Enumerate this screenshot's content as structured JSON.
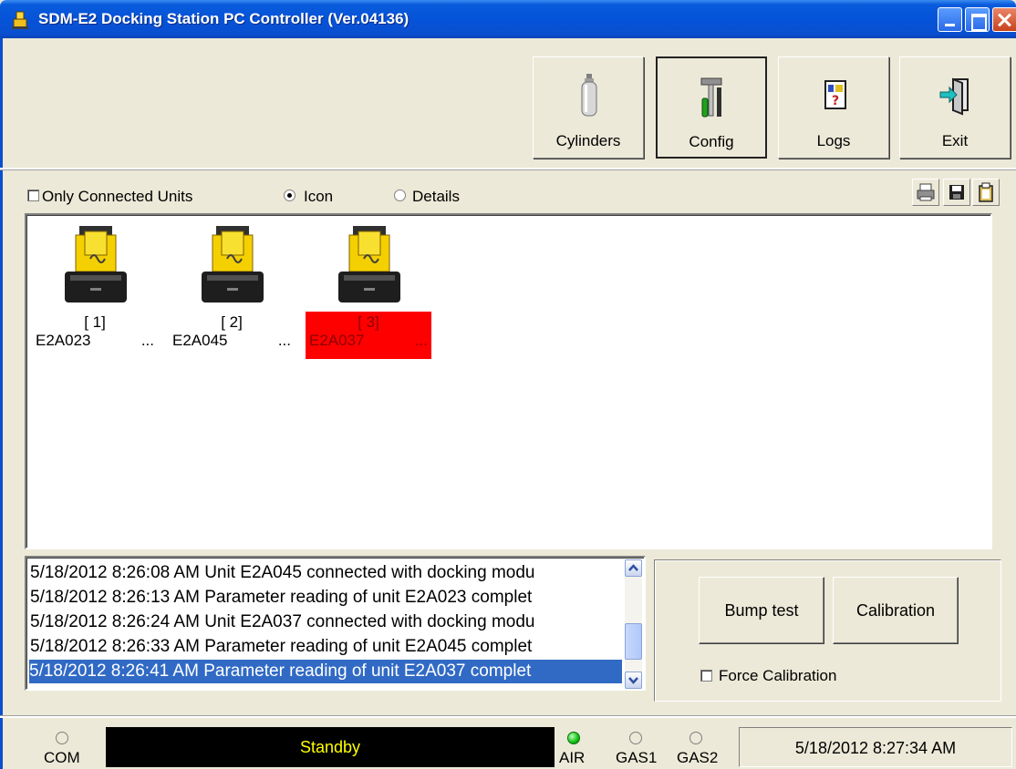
{
  "window": {
    "title": "SDM-E2 Docking Station PC Controller (Ver.04136)"
  },
  "toolbar": {
    "cylinders_label": "Cylinders",
    "config_label": "Config",
    "logs_label": "Logs",
    "exit_label": "Exit"
  },
  "filters": {
    "only_connected_label": "Only Connected Units",
    "only_connected_checked": false,
    "view_icon_label": "Icon",
    "view_details_label": "Details",
    "selected_view": "Icon"
  },
  "units": [
    {
      "num": "[ 1]",
      "name": "E2A023",
      "ellipsis": "...",
      "selected": false
    },
    {
      "num": "[ 2]",
      "name": "E2A045",
      "ellipsis": "...",
      "selected": false
    },
    {
      "num": "[ 3]",
      "name": "E2A037",
      "ellipsis": "...",
      "selected": true
    }
  ],
  "log": [
    "5/18/2012 8:26:08 AM Unit E2A045 connected with docking modu",
    "5/18/2012 8:26:13 AM Parameter reading of unit E2A023 complet",
    "5/18/2012 8:26:24 AM Unit E2A037 connected with docking modu",
    "5/18/2012 8:26:33 AM Parameter reading of unit E2A045 complet",
    "5/18/2012 8:26:41 AM Parameter reading of unit E2A037 complet"
  ],
  "actions": {
    "bump_label": "Bump test",
    "calibration_label": "Calibration",
    "force_calibration_label": "Force Calibration",
    "force_calibration_checked": false
  },
  "status": {
    "com_label": "COM",
    "message": "Standby",
    "air_label": "AIR",
    "gas1_label": "GAS1",
    "gas2_label": "GAS2",
    "datetime": "5/18/2012 8:27:34 AM"
  },
  "colors": {
    "selected_unit_bg": "#ff0000",
    "selected_log_bg": "#316ac5",
    "status_text": "#ffff00",
    "air_led": "#10c010"
  }
}
